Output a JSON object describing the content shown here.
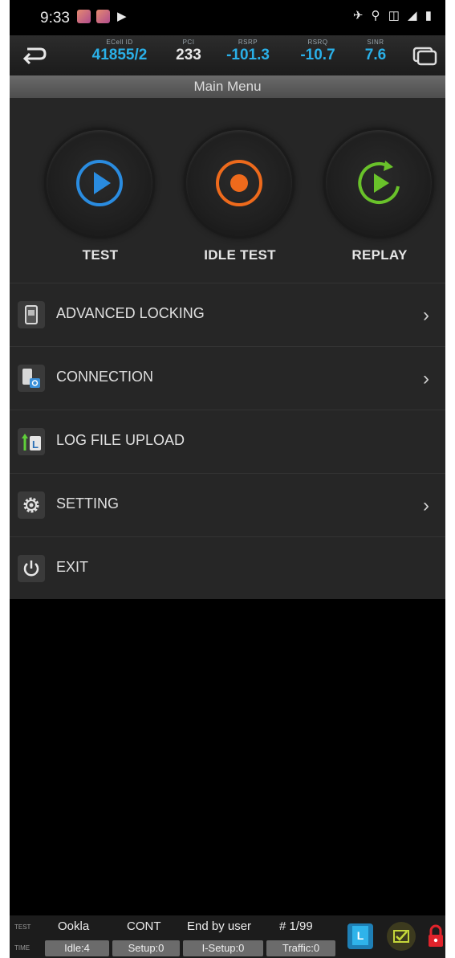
{
  "status_bar": {
    "time": "9:33",
    "play_glyph": "▶",
    "right_icons": "✈ ⚲ ◫ ◢ ▮"
  },
  "info_bar": {
    "metrics": [
      {
        "label": "ECell ID",
        "value": "41855/2"
      },
      {
        "label": "PCI",
        "value": "233"
      },
      {
        "label": "RSRP",
        "value": "-101.3"
      },
      {
        "label": "RSRQ",
        "value": "-10.7"
      },
      {
        "label": "SINR",
        "value": "7.6"
      }
    ]
  },
  "menu": {
    "title": "Main Menu",
    "actions": [
      {
        "label": "TEST",
        "icon": "play-icon",
        "color": "#2a8ce0"
      },
      {
        "label": "IDLE TEST",
        "icon": "record-icon",
        "color": "#ee6a1c"
      },
      {
        "label": "REPLAY",
        "icon": "replay-icon",
        "color": "#69c22a"
      }
    ],
    "items": [
      {
        "label": "ADVANCED LOCKING",
        "icon": "phone-lock-icon",
        "has_chevron": true
      },
      {
        "label": "CONNECTION",
        "icon": "connection-icon",
        "has_chevron": true
      },
      {
        "label": "LOG FILE UPLOAD",
        "icon": "log-upload-icon",
        "has_chevron": false
      },
      {
        "label": "SETTING",
        "icon": "gear-icon",
        "has_chevron": true
      },
      {
        "label": "EXIT",
        "icon": "power-icon",
        "has_chevron": false
      }
    ],
    "chevron": "›"
  },
  "bottom_bar": {
    "test_tag": "TEST",
    "time_tag": "TIME",
    "test_name": "Ookla",
    "mode": "CONT",
    "end_condition": "End by user",
    "count": "# 1/99",
    "pills": [
      "Idle:4",
      "Setup:0",
      "I-Setup:0",
      "Traffic:0"
    ],
    "badge_letter": "L"
  }
}
